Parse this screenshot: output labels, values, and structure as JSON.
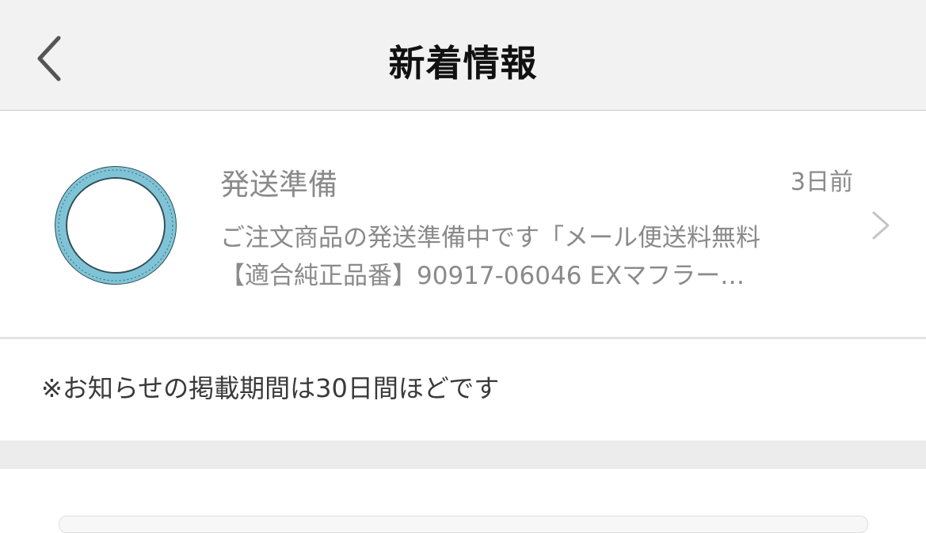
{
  "header": {
    "title": "新着情報",
    "back_icon": "chevron-left-icon"
  },
  "notification": {
    "title": "発送準備",
    "time": "3日前",
    "body_line1": "ご注文商品の発送準備中です「メール便送料無料",
    "body_line2": "【適合純正品番】90917-06046 EXマフラー…",
    "thumbnail": "gasket-ring-image",
    "chevron_icon": "chevron-right-icon",
    "ring_color": "#7fc4d6"
  },
  "note": {
    "text": "※お知らせの掲載期間は30日間ほどです"
  }
}
